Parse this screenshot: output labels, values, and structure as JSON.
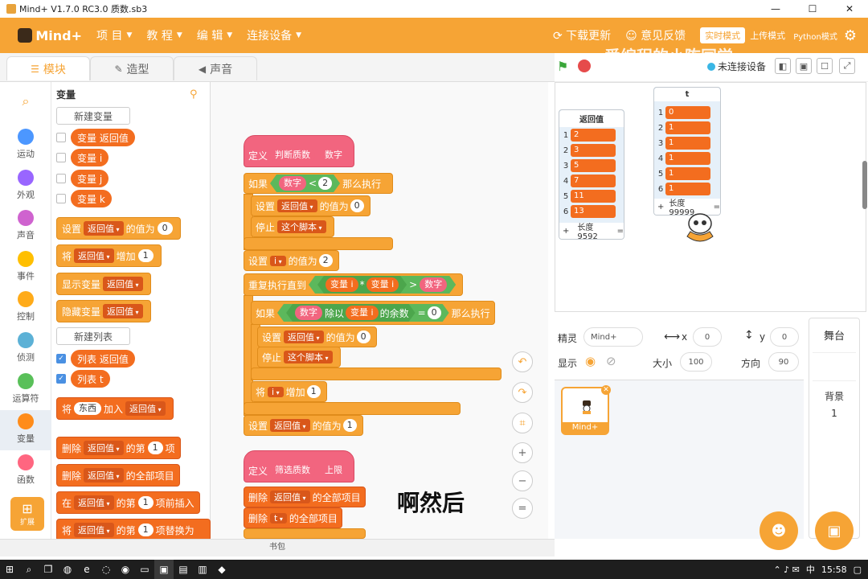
{
  "window": {
    "title": "Mind+ V1.7.0 RC3.0   质数.sb3",
    "min": "—",
    "max": "☐",
    "close": "✕"
  },
  "menu": {
    "logo": "Mind+",
    "items": [
      "项 目",
      "教 程",
      "编 辑",
      "连接设备"
    ],
    "download": "下载更新",
    "feedback": "意见反馈",
    "mode": "实时模式",
    "upload_mode": "上传模式",
    "python": "Python模式",
    "watermark": "爱编程的小陈同学"
  },
  "tabs": {
    "code": "模块",
    "costume": "造型",
    "sound": "声音"
  },
  "stage_bar": {
    "connect": "未连接设备"
  },
  "categories": [
    "运动",
    "外观",
    "声音",
    "事件",
    "控制",
    "侦测",
    "运算符",
    "变量",
    "函数"
  ],
  "category_colors": [
    "#4c97ff",
    "#9966ff",
    "#cf63cf",
    "#ffbf00",
    "#ffab19",
    "#5cb1d6",
    "#59c059",
    "#ff8c1a",
    "#ff6680"
  ],
  "extension": "扩展",
  "palette": {
    "title": "变量",
    "new_variable": "新建变量",
    "variables": [
      "变量 返回值",
      "变量 i",
      "变量 j",
      "变量 k"
    ],
    "set_label": "设置",
    "set_var": "返回值",
    "set_to": "的值为",
    "set_val": "0",
    "change_label": "将",
    "change_var": "返回值",
    "change_by": "增加",
    "change_val": "1",
    "show_var": "显示变量",
    "show_var_name": "返回值",
    "hide_var": "隐藏变量",
    "hide_var_name": "返回值",
    "new_list": "新建列表",
    "lists": [
      "列表 返回值",
      "列表 t"
    ],
    "add_label": "将",
    "add_item": "东西",
    "add_to": "加入",
    "add_list": "返回值",
    "del_label": "删除",
    "del_list": "返回值",
    "del_of": "的第",
    "del_idx": "1",
    "del_item": "项",
    "delall_label": "删除",
    "delall_list": "返回值",
    "delall_text": "的全部项目",
    "ins_label": "在",
    "ins_list": "返回值",
    "ins_of": "的第",
    "ins_idx": "1",
    "ins_text": "项前插入",
    "rep_label": "将",
    "rep_list": "返回值",
    "rep_of": "的第",
    "rep_idx": "1",
    "rep_text": "项替换为"
  },
  "code": {
    "def1": "定义",
    "def1_name": "判断质数",
    "def1_param": "数字",
    "if1": "如果",
    "if1_var": "数字",
    "if1_op": "<",
    "if1_val": "2",
    "if1_then": "那么执行",
    "set1": "设置",
    "set1_var": "返回值",
    "set1_to": "的值为",
    "set1_val": "0",
    "stop1": "停止",
    "stop1_opt": "这个脚本",
    "set2": "设置",
    "set2_var": "i",
    "set2_to": "的值为",
    "set2_val": "2",
    "repeat": "重复执行直到",
    "rep_v1": "变量 i",
    "rep_mul": "*",
    "rep_v2": "变量 i",
    "rep_gt": ">",
    "rep_num": "数字",
    "if2": "如果",
    "if2_a": "数字",
    "if2_mod": "除以",
    "if2_b": "变量 i",
    "if2_rem": "的余数",
    "if2_eq": "=",
    "if2_val": "0",
    "if2_then": "那么执行",
    "set3": "设置",
    "set3_var": "返回值",
    "set3_to": "的值为",
    "set3_val": "0",
    "stop2": "停止",
    "stop2_opt": "这个脚本",
    "inc": "将",
    "inc_var": "i",
    "inc_by": "增加",
    "inc_val": "1",
    "set4": "设置",
    "set4_var": "返回值",
    "set4_to": "的值为",
    "set4_val": "1",
    "def2": "定义",
    "def2_name": "筛选质数",
    "def2_param": "上限",
    "del1": "删除",
    "del1_list": "返回值",
    "del1_text": "的全部项目",
    "del2": "删除",
    "del2_list": "t",
    "del2_text": "的全部项目",
    "subtitle": "啊然后"
  },
  "backpack": "书包",
  "monitor_ret": {
    "title": "返回值",
    "rows": [
      [
        "1",
        "2"
      ],
      [
        "2",
        "3"
      ],
      [
        "3",
        "5"
      ],
      [
        "4",
        "7"
      ],
      [
        "5",
        "11"
      ],
      [
        "6",
        "13"
      ]
    ],
    "footer_plus": "+",
    "footer_len": "长度9592",
    "footer_eq": "="
  },
  "monitor_t": {
    "title": "t",
    "rows": [
      [
        "1",
        "0"
      ],
      [
        "2",
        "1"
      ],
      [
        "3",
        "1"
      ],
      [
        "4",
        "1"
      ],
      [
        "5",
        "1"
      ],
      [
        "6",
        "1"
      ]
    ],
    "footer_plus": "+",
    "footer_len": "长度99999",
    "footer_eq": "="
  },
  "sprite": {
    "label": "精灵",
    "name": "Mind+",
    "x_label": "x",
    "x": "0",
    "y_label": "y",
    "y": "0",
    "show_label": "显示",
    "size_label": "大小",
    "size": "100",
    "dir_label": "方向",
    "dir": "90",
    "thumb_label": "Mind+"
  },
  "stage_panel": {
    "title": "舞台",
    "bg_label": "背景",
    "bg_count": "1"
  },
  "taskbar": {
    "time": "15:58",
    "ime": "中"
  }
}
